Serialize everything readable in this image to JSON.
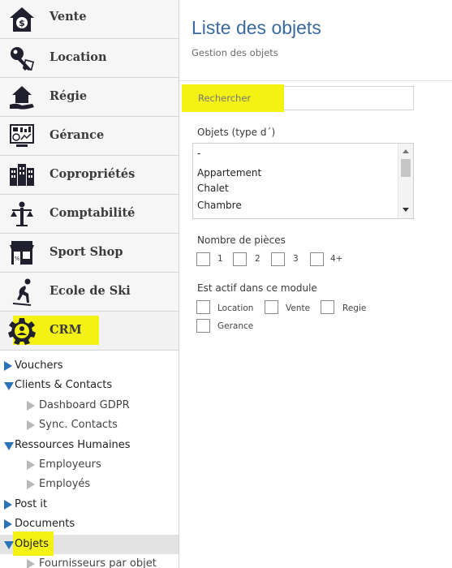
{
  "sidebar": {
    "modules": [
      {
        "label": "Vente",
        "icon": "house-dollar-icon"
      },
      {
        "label": "Location",
        "icon": "keys-icon"
      },
      {
        "label": "Régie",
        "icon": "hand-house-icon"
      },
      {
        "label": "Gérance",
        "icon": "dashboard-screen-icon"
      },
      {
        "label": "Copropriétés",
        "icon": "buildings-icon"
      },
      {
        "label": "Comptabilité",
        "icon": "scales-person-icon"
      },
      {
        "label": "Sport Shop",
        "icon": "shop-icon"
      },
      {
        "label": "Ecole de Ski",
        "icon": "skier-icon"
      },
      {
        "label": "CRM",
        "icon": "gear-person-icon"
      }
    ],
    "tree": [
      {
        "label": "Vouchers"
      },
      {
        "label": "Clients & Contacts"
      },
      {
        "label": "Dashboard GDPR"
      },
      {
        "label": "Sync. Contacts"
      },
      {
        "label": "Ressources Humaines"
      },
      {
        "label": "Employeurs"
      },
      {
        "label": "Employés"
      },
      {
        "label": "Post it"
      },
      {
        "label": "Documents"
      },
      {
        "label": "Objets"
      },
      {
        "label": "Fournisseurs par objet"
      }
    ]
  },
  "main": {
    "title": "Liste des objets",
    "subtitle": "Gestion des objets",
    "search_placeholder": "Rechercher",
    "types_label": "Objets (type d´)",
    "types_options": [
      "-",
      "Appartement",
      "Chalet",
      "Chambre"
    ],
    "rooms_label": "Nombre de pièces",
    "rooms_options": [
      "1",
      "2",
      "3",
      "4+"
    ],
    "modules_label": "Est actif dans ce module",
    "modules_options": [
      "Location",
      "Vente",
      "Regie",
      "Gerance"
    ]
  },
  "colors": {
    "accent": "#2b73b8",
    "title": "#3b6aa0",
    "highlight": "#f4f214",
    "icon": "#1f1f2e"
  }
}
